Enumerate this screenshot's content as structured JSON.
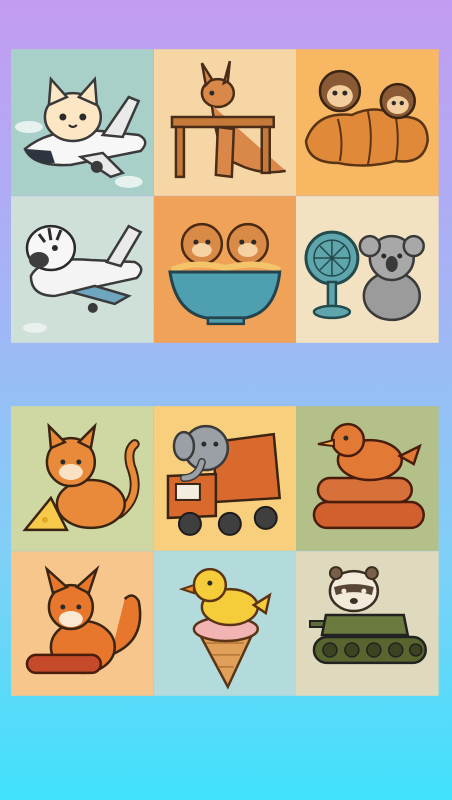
{
  "game": {
    "colors": {
      "background_top": "#c39cf2",
      "background_bottom": "#3fe1fb"
    },
    "board_top": {
      "tiles": [
        {
          "icon": "cat-airplane-icon",
          "bg": "#a9cfc9"
        },
        {
          "icon": "kangaroo-table-icon",
          "bg": "#f5d6a4"
        },
        {
          "icon": "monkeys-croissant-icon",
          "bg": "#f7b763"
        },
        {
          "icon": "zebra-airplane-icon",
          "bg": "#cfe0d9"
        },
        {
          "icon": "hamsters-noodle-bowl-icon",
          "bg": "#f0a259"
        },
        {
          "icon": "koala-fan-icon",
          "bg": "#f3e2c2"
        }
      ]
    },
    "board_bottom": {
      "tiles": [
        {
          "icon": "tiger-cat-cheese-icon",
          "bg": "#cfd7a2"
        },
        {
          "icon": "elephant-truck-icon",
          "bg": "#f8cf7d"
        },
        {
          "icon": "bird-sausages-icon",
          "bg": "#b4c089"
        },
        {
          "icon": "fox-sausage-icon",
          "bg": "#f7c68d"
        },
        {
          "icon": "duck-ice-cream-icon",
          "bg": "#b4dbdb"
        },
        {
          "icon": "ferret-tank-icon",
          "bg": "#dfd9bd"
        }
      ]
    }
  }
}
